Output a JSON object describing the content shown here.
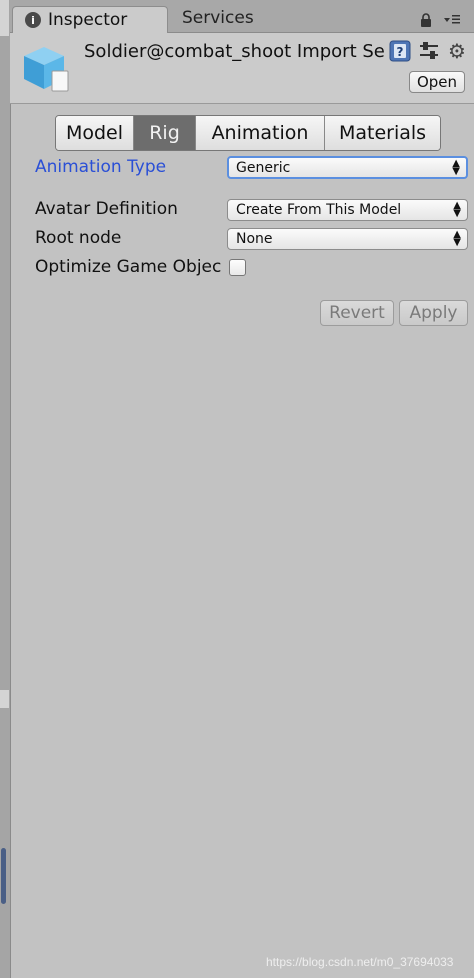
{
  "tabs": {
    "inspector_label": "Inspector",
    "services_label": "Services"
  },
  "header": {
    "title": "Soldier@combat_shoot Import Se",
    "open_label": "Open"
  },
  "rig_tabs": [
    "Model",
    "Rig",
    "Animation",
    "Materials"
  ],
  "selected_tab": "Rig",
  "fields": {
    "animation_type_label": "Animation Type",
    "animation_type_value": "Generic",
    "avatar_definition_label": "Avatar Definition",
    "avatar_definition_value": "Create From This Model",
    "root_node_label": "Root node",
    "root_node_value": "None",
    "optimize_label": "Optimize Game Objec",
    "optimize_checked": false
  },
  "buttons": {
    "revert_label": "Revert",
    "apply_label": "Apply"
  },
  "watermark": "https://blog.csdn.net/m0_37694033",
  "icons": [
    "info-icon",
    "lock-icon",
    "tab-menu-icon",
    "cube-asset-icon",
    "help-icon",
    "preset-icon",
    "gear-icon",
    "dropdown-arrow-icon"
  ],
  "colors": {
    "accent_label": "#2a4fd6",
    "selected_segment": "#6d6d6d",
    "panel_bg": "#c2c2c2",
    "focus_ring": "#5b8fe0"
  }
}
